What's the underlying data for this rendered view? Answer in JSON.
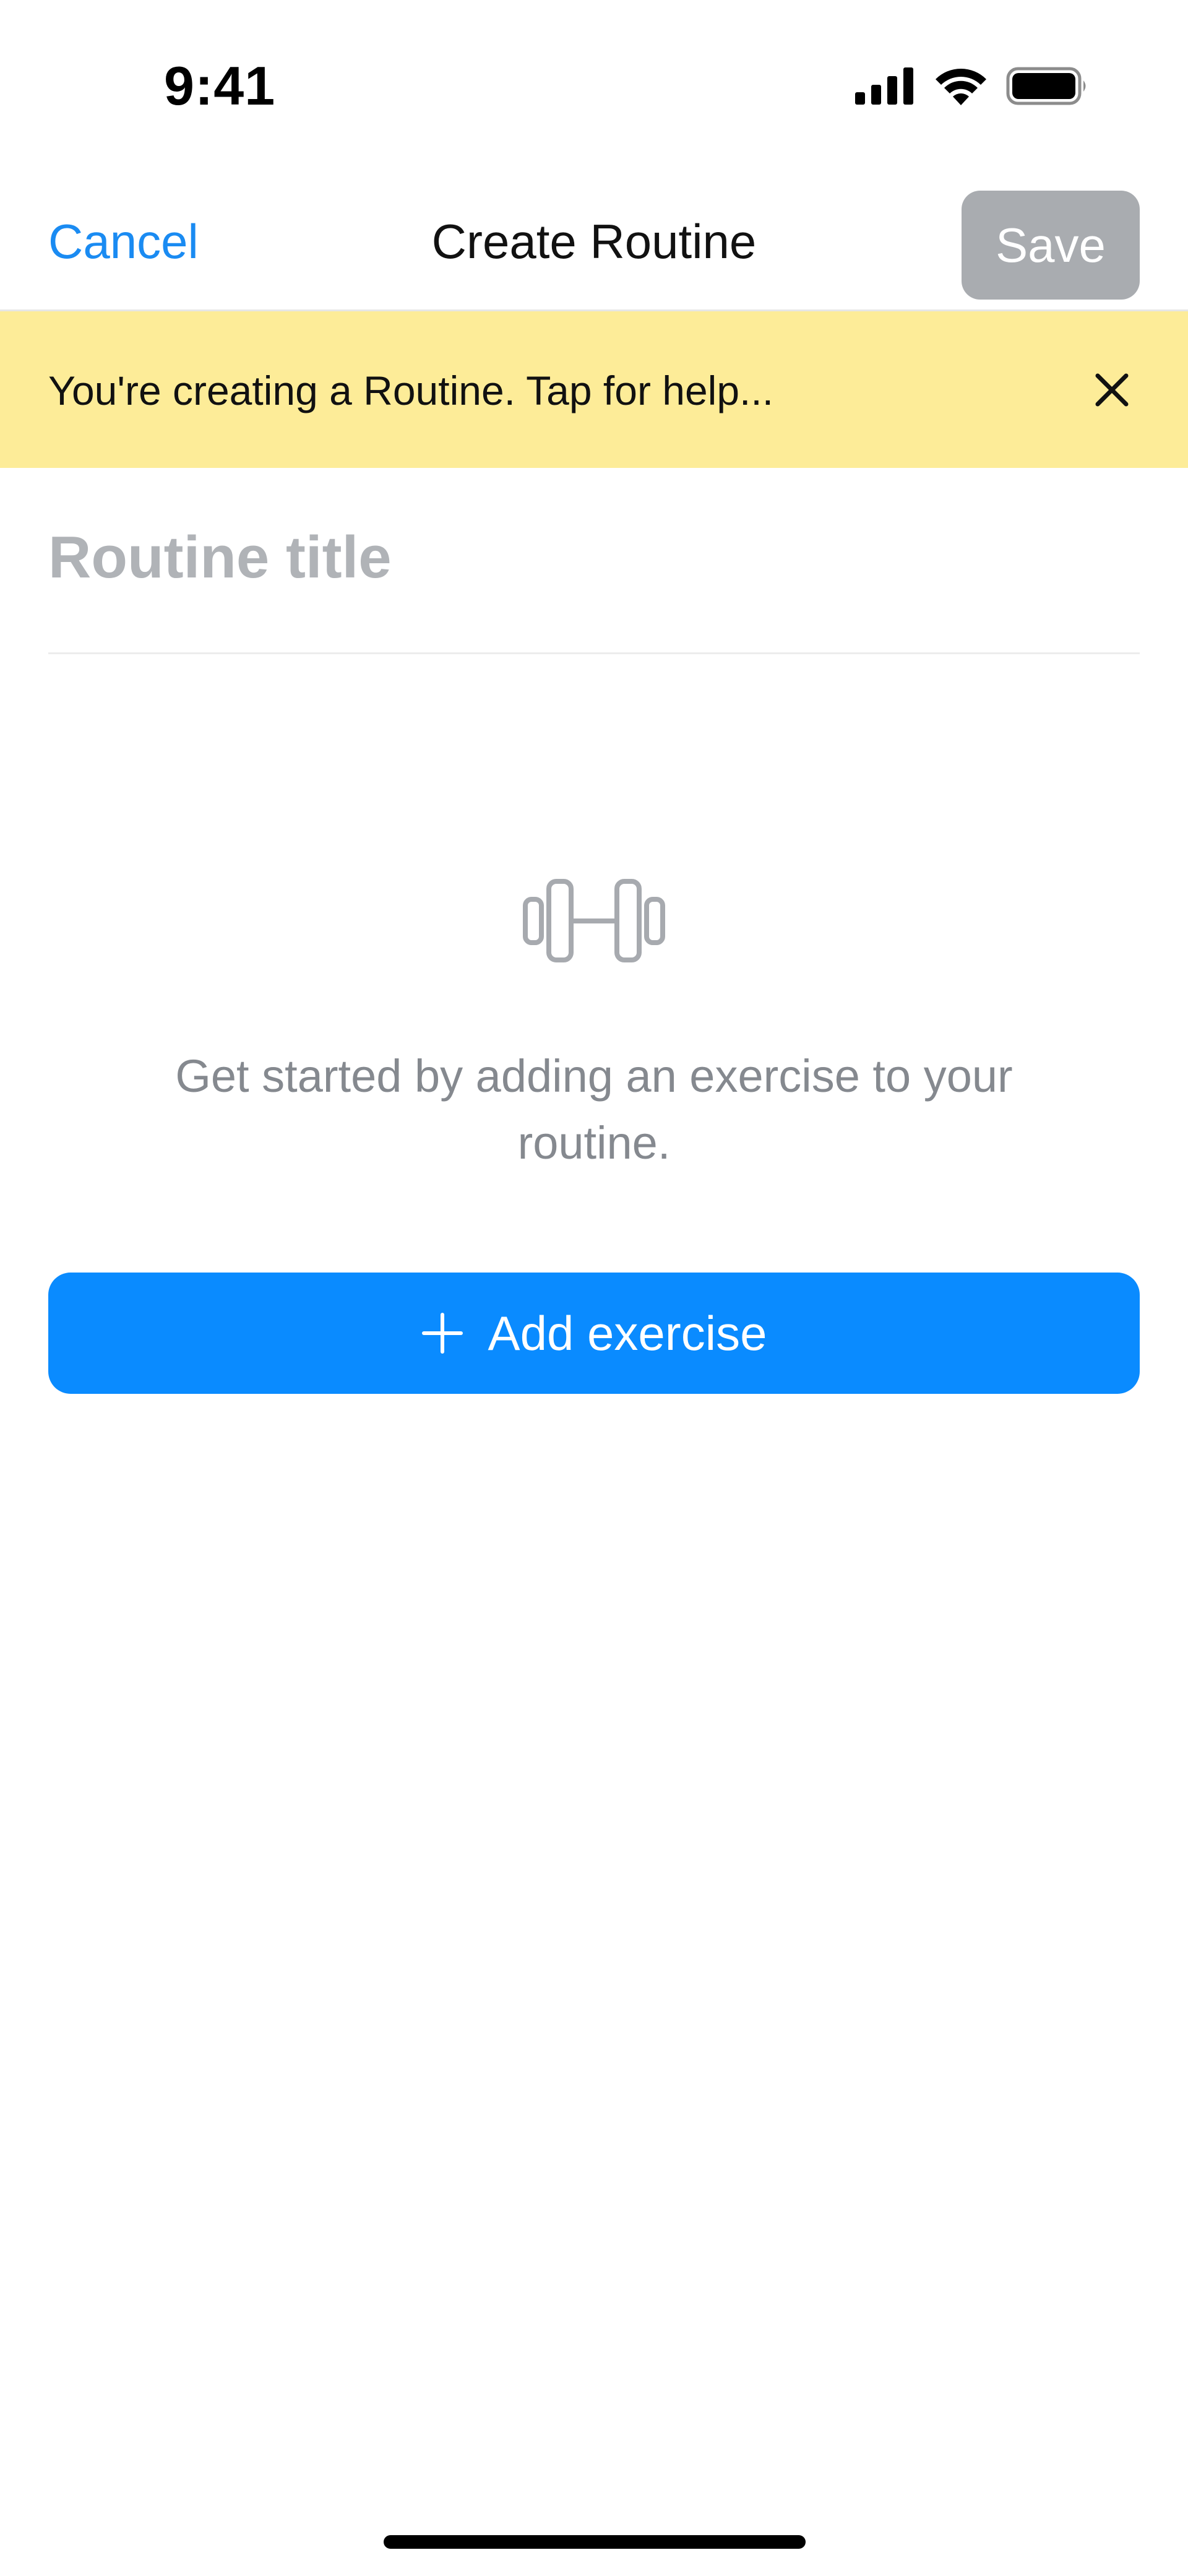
{
  "status_bar": {
    "time": "9:41"
  },
  "nav": {
    "cancel_label": "Cancel",
    "title": "Create Routine",
    "save_label": "Save"
  },
  "banner": {
    "text": "You're creating a Routine. Tap for help...",
    "background": "#fdec98"
  },
  "title_input": {
    "placeholder": "Routine title",
    "value": ""
  },
  "empty_state": {
    "icon": "dumbbell-icon",
    "text": "Get started by adding an exercise to your routine."
  },
  "add_exercise": {
    "label": "Add exercise",
    "icon": "plus-icon"
  },
  "colors": {
    "accent": "#0a8bff",
    "link": "#1a8bf2",
    "save_disabled": "#a9acb0",
    "muted_text": "#85898f"
  }
}
